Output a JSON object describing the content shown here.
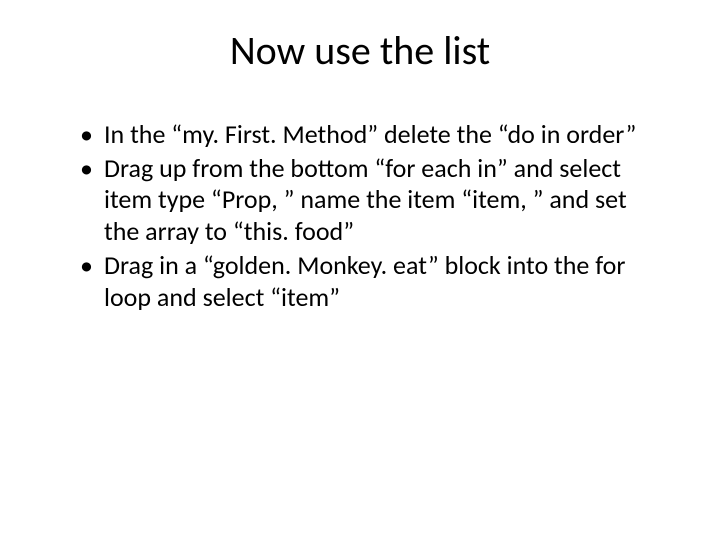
{
  "slide": {
    "title": "Now use the list",
    "bullets": [
      "In the “my. First. Method” delete the “do in order”",
      "Drag up from the bottom “for each in” and select item type “Prop, ” name the item “item, ” and set the array to “this. food”",
      "Drag in a “golden. Monkey. eat” block into the for loop and select “item”"
    ]
  }
}
